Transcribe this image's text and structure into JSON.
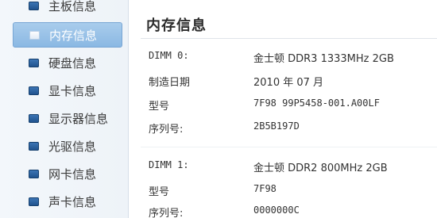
{
  "sidebar": {
    "items": [
      {
        "label": "主板信息",
        "icon": "board-icon"
      },
      {
        "label": "内存信息",
        "icon": "memory-icon",
        "active": true
      },
      {
        "label": "硬盘信息",
        "icon": "disk-icon"
      },
      {
        "label": "显卡信息",
        "icon": "gpu-icon"
      },
      {
        "label": "显示器信息",
        "icon": "monitor-icon"
      },
      {
        "label": "光驱信息",
        "icon": "optical-drive-icon"
      },
      {
        "label": "网卡信息",
        "icon": "network-card-icon"
      },
      {
        "label": "声卡信息",
        "icon": "sound-card-icon"
      }
    ]
  },
  "main": {
    "title": "内存信息",
    "modules": [
      {
        "rows": [
          {
            "key": "DIMM 0:",
            "value": "金士顿 DDR3 1333MHz 2GB"
          },
          {
            "key": "制造日期",
            "value": "2010 年 07 月"
          },
          {
            "key": "型号",
            "value": "7F98 99P5458-001.A00LF"
          },
          {
            "key": "序列号:",
            "value": "2B5B197D"
          }
        ]
      },
      {
        "rows": [
          {
            "key": "DIMM 1:",
            "value": "金士顿 DDR2 800MHz 2GB"
          },
          {
            "key": "型号",
            "value": "7F98"
          },
          {
            "key": "序列号:",
            "value": "0000000C"
          }
        ]
      }
    ]
  }
}
